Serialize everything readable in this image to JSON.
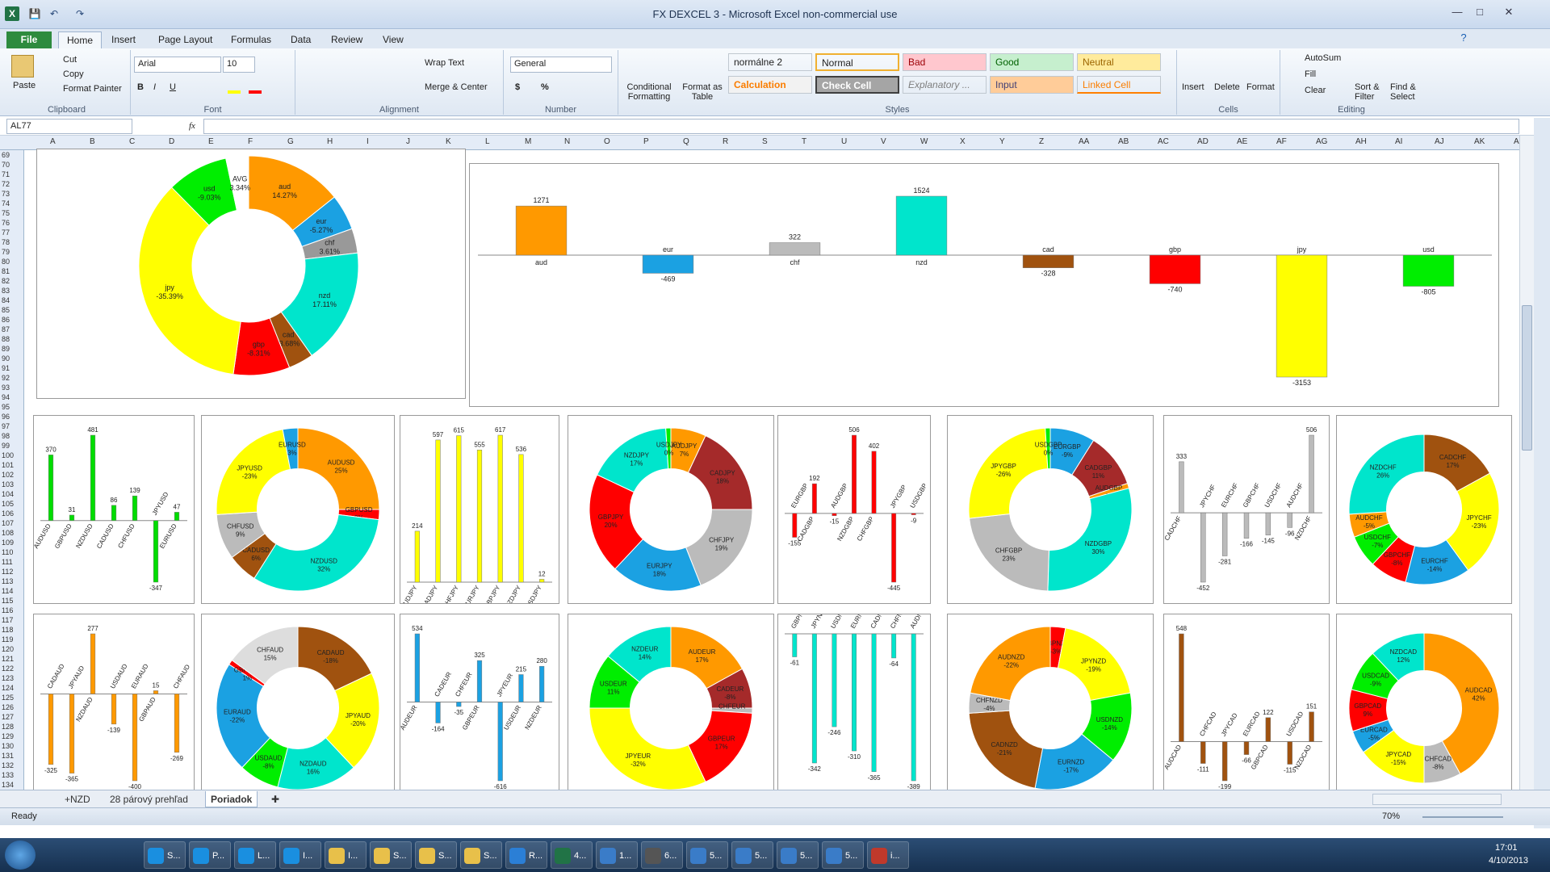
{
  "window": {
    "title": "FX DEXCEL 3  -  Microsoft Excel non-commercial use"
  },
  "ribbon_tabs": [
    "File",
    "Home",
    "Insert",
    "Page Layout",
    "Formulas",
    "Data",
    "Review",
    "View"
  ],
  "clipboard": {
    "paste": "Paste",
    "cut": "Cut",
    "copy": "Copy",
    "format_painter": "Format Painter",
    "label": "Clipboard"
  },
  "font": {
    "name": "Arial",
    "size": "10",
    "label": "Font"
  },
  "alignment": {
    "wrap": "Wrap Text",
    "merge": "Merge & Center",
    "label": "Alignment"
  },
  "number": {
    "format": "General",
    "label": "Number"
  },
  "styles": {
    "conditional": "Conditional Formatting",
    "as_table": "Format as Table",
    "items": [
      {
        "name": "normálne 2",
        "bg": "#ffffff",
        "fg": "#000000"
      },
      {
        "name": "Normal",
        "bg": "#ffffff",
        "fg": "#000000"
      },
      {
        "name": "Bad",
        "bg": "#ffc7ce",
        "fg": "#9c0006"
      },
      {
        "name": "Good",
        "bg": "#c6efce",
        "fg": "#006100"
      },
      {
        "name": "Neutral",
        "bg": "#ffeb9c",
        "fg": "#9c6500"
      },
      {
        "name": "Calculation",
        "bg": "#f2f2f2",
        "fg": "#fa7d00"
      },
      {
        "name": "Check Cell",
        "bg": "#a5a5a5",
        "fg": "#ffffff"
      },
      {
        "name": "Explanatory ...",
        "bg": "#ffffff",
        "fg": "#7f7f7f"
      },
      {
        "name": "Input",
        "bg": "#ffcc99",
        "fg": "#3f3f76"
      },
      {
        "name": "Linked Cell",
        "bg": "#ffffff",
        "fg": "#fa7d00"
      }
    ],
    "label": "Styles"
  },
  "cells": {
    "insert": "Insert",
    "delete": "Delete",
    "format": "Format",
    "label": "Cells"
  },
  "editing": {
    "autosum": "AutoSum",
    "fill": "Fill",
    "clear": "Clear",
    "sort": "Sort & Filter",
    "find": "Find & Select",
    "label": "Editing"
  },
  "name_box": "AL77",
  "fx": "fx",
  "columns": [
    "A",
    "B",
    "C",
    "D",
    "E",
    "F",
    "G",
    "H",
    "I",
    "J",
    "K",
    "L",
    "M",
    "N",
    "O",
    "P",
    "Q",
    "R",
    "S",
    "T",
    "U",
    "V",
    "W",
    "X",
    "Y",
    "Z",
    "AA",
    "AB",
    "AC",
    "AD",
    "AE",
    "AF",
    "AG",
    "AH",
    "AI",
    "AJ",
    "AK",
    "AL"
  ],
  "rows": [
    "69",
    "70",
    "71",
    "72",
    "73",
    "74",
    "75",
    "76",
    "77",
    "78",
    "79",
    "80",
    "81",
    "82",
    "83",
    "84",
    "85",
    "86",
    "87",
    "88",
    "89",
    "90",
    "91",
    "92",
    "93",
    "94",
    "95",
    "96",
    "97",
    "98",
    "99",
    "100",
    "101",
    "102",
    "103",
    "104",
    "105",
    "106",
    "107",
    "108",
    "109",
    "110",
    "111",
    "112",
    "113",
    "114",
    "115",
    "116",
    "117",
    "118",
    "119",
    "120",
    "121",
    "122",
    "123",
    "124",
    "125",
    "126",
    "127",
    "128",
    "129",
    "130",
    "131",
    "132",
    "133",
    "134"
  ],
  "sheet_tabs": [
    "+NZD",
    "28 párový prehľad",
    "Poriadok"
  ],
  "status": {
    "ready": "Ready",
    "zoom": "70%"
  },
  "taskbar": {
    "time": "17:01",
    "date": "4/10/2013",
    "items": [
      "S...",
      "P...",
      "L...",
      "I...",
      "I...",
      "S...",
      "S...",
      "S...",
      "R...",
      "4...",
      "1...",
      "6...",
      "5...",
      "5...",
      "5...",
      "5...",
      "i..."
    ]
  },
  "chart_data": [
    {
      "id": "main-donut",
      "type": "pie",
      "hole": true,
      "slices": [
        {
          "label": "aud",
          "value": 14.27,
          "text": "14.27%",
          "color": "#ff9900"
        },
        {
          "label": "eur",
          "value": 5.27,
          "text": "-5.27%",
          "color": "#1ba1e2"
        },
        {
          "label": "chf",
          "value": 3.61,
          "text": "3.61%",
          "color": "#999999"
        },
        {
          "label": "nzd",
          "value": 17.11,
          "text": "17.11%",
          "color": "#00e5cc"
        },
        {
          "label": "cad",
          "value": 3.68,
          "text": "-3.68%",
          "color": "#a0520f"
        },
        {
          "label": "gbp",
          "value": 8.31,
          "text": "-8.31%",
          "color": "#ff0000"
        },
        {
          "label": "jpy",
          "value": 35.39,
          "text": "-35.39%",
          "color": "#ffff00"
        },
        {
          "label": "usd",
          "value": 9.03,
          "text": "-9.03%",
          "color": "#00ee00"
        },
        {
          "label": "AVG",
          "value": 3.34,
          "text": "3.34%",
          "color": "#ffffff"
        }
      ]
    },
    {
      "id": "main-bar",
      "type": "bar",
      "categories": [
        "aud",
        "eur",
        "chf",
        "nzd",
        "cad",
        "gbp",
        "jpy",
        "usd"
      ],
      "values": [
        1271,
        -469,
        322,
        1524,
        -328,
        -740,
        -3153,
        -805
      ],
      "colors": [
        "#ff9900",
        "#1ba1e2",
        "#bbbbbb",
        "#00e5cc",
        "#a0520f",
        "#ff0000",
        "#ffff00",
        "#00ee00"
      ]
    },
    {
      "id": "usd-bar",
      "type": "bar",
      "categories": [
        "AUDUSD",
        "GBPUSD",
        "NZDUSD",
        "CADUSD",
        "CHFUSD",
        "JPYUSD",
        "EURUSD"
      ],
      "values": [
        370,
        31,
        481,
        86,
        139,
        -347,
        47
      ],
      "color": "#00dd00"
    },
    {
      "id": "usd-donut",
      "type": "pie",
      "slices": [
        {
          "label": "AUDUSD",
          "text": "25%",
          "value": 25,
          "color": "#ff9900"
        },
        {
          "label": "GBPUSD",
          "text": "2%",
          "value": 2,
          "color": "#ff0000"
        },
        {
          "label": "NZDUSD",
          "text": "32%",
          "value": 32,
          "color": "#00e5cc"
        },
        {
          "label": "CADUSD",
          "text": "6%",
          "value": 6,
          "color": "#a0520f"
        },
        {
          "label": "CHFUSD",
          "text": "9%",
          "value": 9,
          "color": "#bbbbbb"
        },
        {
          "label": "JPYUSD",
          "text": "-23%",
          "value": 23,
          "color": "#ffff00"
        },
        {
          "label": "EURUSD",
          "text": "3%",
          "value": 3,
          "color": "#1ba1e2"
        }
      ]
    },
    {
      "id": "jpy-bar",
      "type": "bar",
      "categories": [
        "AUDJPY",
        "CADJPY",
        "CHFJPY",
        "EURJPY",
        "GBPJPY",
        "NZDJPY",
        "USDJPY"
      ],
      "values": [
        214,
        597,
        615,
        555,
        617,
        536,
        12
      ],
      "color": "#ffff00"
    },
    {
      "id": "jpy-donut",
      "type": "pie",
      "slices": [
        {
          "label": "AUDJPY",
          "text": "7%",
          "value": 7,
          "color": "#ff9900"
        },
        {
          "label": "CADJPY",
          "text": "18%",
          "value": 18,
          "color": "#a52a2a"
        },
        {
          "label": "CHFJPY",
          "text": "19%",
          "value": 19,
          "color": "#bbbbbb"
        },
        {
          "label": "EURJPY",
          "text": "18%",
          "value": 18,
          "color": "#1ba1e2"
        },
        {
          "label": "GBPJPY",
          "text": "20%",
          "value": 20,
          "color": "#ff0000"
        },
        {
          "label": "NZDJPY",
          "text": "17%",
          "value": 17,
          "color": "#00e5cc"
        },
        {
          "label": "USDJPY",
          "text": "0%",
          "value": 1,
          "color": "#00ee00"
        }
      ]
    },
    {
      "id": "gbp-bar",
      "type": "bar",
      "categories": [
        "EURGBP",
        "CADGBP",
        "AUDGBP",
        "NZDGBP",
        "CHFGBP",
        "JPYGBP",
        "USDGBP"
      ],
      "values": [
        -155,
        192,
        -15,
        506,
        402,
        -445,
        -9
      ],
      "color": "#ff0000"
    },
    {
      "id": "gbp-donut",
      "type": "pie",
      "slices": [
        {
          "label": "EURGBP",
          "text": "-9%",
          "value": 9,
          "color": "#1ba1e2"
        },
        {
          "label": "CADGBP",
          "text": "11%",
          "value": 11,
          "color": "#a52a2a"
        },
        {
          "label": "AUDGBP",
          "text": "-1%",
          "value": 1,
          "color": "#ff9900"
        },
        {
          "label": "NZDGBP",
          "text": "30%",
          "value": 30,
          "color": "#00e5cc"
        },
        {
          "label": "CHFGBP",
          "text": "23%",
          "value": 23,
          "color": "#bbbbbb"
        },
        {
          "label": "JPYGBP",
          "text": "-26%",
          "value": 26,
          "color": "#ffff00"
        },
        {
          "label": "USDGBP",
          "text": "0%",
          "value": 1,
          "color": "#00ee00"
        }
      ]
    },
    {
      "id": "chf-bar",
      "type": "bar",
      "categories": [
        "CADCHF",
        "JPYCHF",
        "EURCHF",
        "GBPCHF",
        "USDCHF",
        "AUDCHF",
        "NZDCHF"
      ],
      "values": [
        333,
        -452,
        -281,
        -166,
        -145,
        -96,
        506
      ],
      "color": "#bbbbbb"
    },
    {
      "id": "chf-donut",
      "type": "pie",
      "slices": [
        {
          "label": "CADCHF",
          "text": "17%",
          "value": 17,
          "color": "#a0520f"
        },
        {
          "label": "JPYCHF",
          "text": "-23%",
          "value": 23,
          "color": "#ffff00"
        },
        {
          "label": "EURCHF",
          "text": "-14%",
          "value": 14,
          "color": "#1ba1e2"
        },
        {
          "label": "GBPCHF",
          "text": "-8%",
          "value": 8,
          "color": "#ff0000"
        },
        {
          "label": "USDCHF",
          "text": "-7%",
          "value": 7,
          "color": "#00ee00"
        },
        {
          "label": "AUDCHF",
          "text": "-5%",
          "value": 5,
          "color": "#ff9900"
        },
        {
          "label": "NZDCHF",
          "text": "26%",
          "value": 26,
          "color": "#00e5cc"
        }
      ]
    },
    {
      "id": "aud-bar",
      "type": "bar",
      "categories": [
        "CADAUD",
        "JPYAUD",
        "NZDAUD",
        "USDAUD",
        "EURAUD",
        "GBPAUD",
        "CHFAUD"
      ],
      "values": [
        -325,
        -365,
        277,
        -139,
        -400,
        15,
        -269
      ],
      "color": "#ff9900"
    },
    {
      "id": "aud-donut",
      "type": "pie",
      "slices": [
        {
          "label": "CADAUD",
          "text": "-18%",
          "value": 18,
          "color": "#a0520f"
        },
        {
          "label": "JPYAUD",
          "text": "-20%",
          "value": 20,
          "color": "#ffff00"
        },
        {
          "label": "NZDAUD",
          "text": "16%",
          "value": 16,
          "color": "#00e5cc"
        },
        {
          "label": "USDAUD",
          "text": "-8%",
          "value": 8,
          "color": "#00ee00"
        },
        {
          "label": "EURAUD",
          "text": "-22%",
          "value": 22,
          "color": "#1ba1e2"
        },
        {
          "label": "GBPAUD",
          "text": "1%",
          "value": 1,
          "color": "#ff0000"
        },
        {
          "label": "CHFAUD",
          "text": "15%",
          "value": 15,
          "color": "#dddddd"
        }
      ]
    },
    {
      "id": "eur-bar",
      "type": "bar",
      "categories": [
        "AUDEUR",
        "CADEUR",
        "CHFEUR",
        "GBPEUR",
        "JPYEUR",
        "USDEUR",
        "NZDEUR"
      ],
      "values": [
        534,
        -164,
        -35,
        325,
        -616,
        215,
        280
      ],
      "color": "#1ba1e2"
    },
    {
      "id": "eur-donut",
      "type": "pie",
      "slices": [
        {
          "label": "AUDEUR",
          "text": "17%",
          "value": 17,
          "color": "#ff9900"
        },
        {
          "label": "CADEUR",
          "text": "-8%",
          "value": 8,
          "color": "#a52a2a"
        },
        {
          "label": "CHFEUR",
          "text": "-1%",
          "value": 1,
          "color": "#bbbbbb"
        },
        {
          "label": "GBPEUR",
          "text": "17%",
          "value": 17,
          "color": "#ff0000"
        },
        {
          "label": "JPYEUR",
          "text": "-32%",
          "value": 32,
          "color": "#ffff00"
        },
        {
          "label": "USDEUR",
          "text": "11%",
          "value": 11,
          "color": "#00ee00"
        },
        {
          "label": "NZDEUR",
          "text": "14%",
          "value": 14,
          "color": "#00e5cc"
        }
      ]
    },
    {
      "id": "nzd-bar",
      "type": "bar",
      "categories": [
        "GBPNZD",
        "JPYNZD",
        "USDNZD",
        "EURNZD",
        "CADNZD",
        "CHFNZD",
        "AUDNZD"
      ],
      "values": [
        -61,
        -342,
        -246,
        -310,
        -365,
        -64,
        -389
      ],
      "color": "#00e5cc"
    },
    {
      "id": "nzd-donut",
      "type": "pie",
      "slices": [
        {
          "label": "GBPNZD",
          "text": "-3%",
          "value": 3,
          "color": "#ff0000"
        },
        {
          "label": "JPYNZD",
          "text": "-19%",
          "value": 19,
          "color": "#ffff00"
        },
        {
          "label": "USDNZD",
          "text": "-14%",
          "value": 14,
          "color": "#00ee00"
        },
        {
          "label": "EURNZD",
          "text": "-17%",
          "value": 17,
          "color": "#1ba1e2"
        },
        {
          "label": "CADNZD",
          "text": "-21%",
          "value": 21,
          "color": "#a0520f"
        },
        {
          "label": "CHFNZD",
          "text": "-4%",
          "value": 4,
          "color": "#bbbbbb"
        },
        {
          "label": "AUDNZD",
          "text": "-22%",
          "value": 22,
          "color": "#ff9900"
        }
      ]
    },
    {
      "id": "cad-bar",
      "type": "bar",
      "categories": [
        "AUDCAD",
        "CHFCAD",
        "JPYCAD",
        "EURCAD",
        "GBPCAD",
        "USDCAD",
        "NZDCAD"
      ],
      "values": [
        548,
        -111,
        -199,
        -66,
        122,
        -115,
        151
      ],
      "color": "#a0520f"
    },
    {
      "id": "cad-donut",
      "type": "pie",
      "slices": [
        {
          "label": "AUDCAD",
          "text": "42%",
          "value": 42,
          "color": "#ff9900"
        },
        {
          "label": "CHFCAD",
          "text": "-8%",
          "value": 8,
          "color": "#bbbbbb"
        },
        {
          "label": "JPYCAD",
          "text": "-15%",
          "value": 15,
          "color": "#ffff00"
        },
        {
          "label": "EURCAD",
          "text": "-5%",
          "value": 5,
          "color": "#1ba1e2"
        },
        {
          "label": "GBPCAD",
          "text": "9%",
          "value": 9,
          "color": "#ff0000"
        },
        {
          "label": "USDCAD",
          "text": "-9%",
          "value": 9,
          "color": "#00ee00"
        },
        {
          "label": "NZDCAD",
          "text": "12%",
          "value": 12,
          "color": "#00e5cc"
        }
      ]
    }
  ]
}
